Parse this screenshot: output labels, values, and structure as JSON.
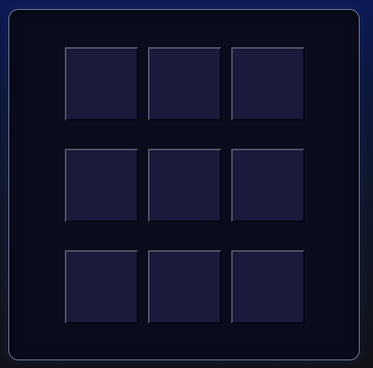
{
  "board": {
    "rows": 3,
    "columns": 3,
    "cells": [
      {
        "id": 1,
        "mark": ""
      },
      {
        "id": 2,
        "mark": ""
      },
      {
        "id": 3,
        "mark": ""
      },
      {
        "id": 4,
        "mark": ""
      },
      {
        "id": 5,
        "mark": ""
      },
      {
        "id": 6,
        "mark": ""
      },
      {
        "id": 7,
        "mark": ""
      },
      {
        "id": 8,
        "mark": ""
      },
      {
        "id": 9,
        "mark": ""
      }
    ]
  },
  "colors": {
    "board_background": "#0a0b1d",
    "board_border": "#8a8fa8",
    "cell_fill": "#1b1a3b",
    "cell_highlight": "#5b5b6e",
    "cell_shadow": "#040410",
    "page_top": "#0b1a55",
    "page_bottom": "#111217"
  }
}
